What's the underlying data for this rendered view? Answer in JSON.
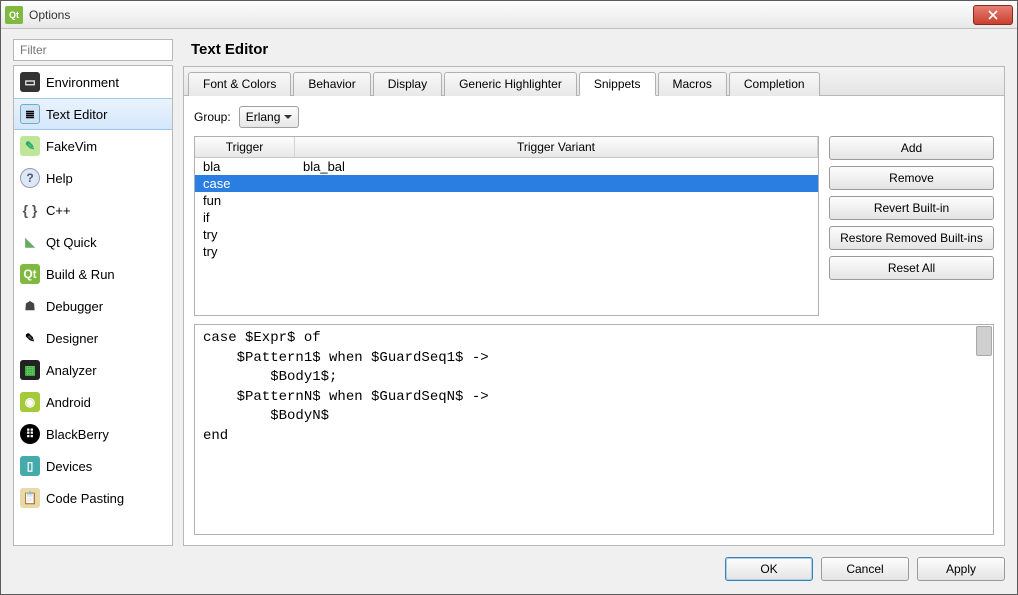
{
  "window": {
    "title": "Options"
  },
  "filter": {
    "placeholder": "Filter"
  },
  "categories": [
    {
      "label": "Environment",
      "icon": "env"
    },
    {
      "label": "Text Editor",
      "icon": "text",
      "selected": true
    },
    {
      "label": "FakeVim",
      "icon": "fakevim"
    },
    {
      "label": "Help",
      "icon": "help"
    },
    {
      "label": "C++",
      "icon": "cpp"
    },
    {
      "label": "Qt Quick",
      "icon": "qtq"
    },
    {
      "label": "Build & Run",
      "icon": "build"
    },
    {
      "label": "Debugger",
      "icon": "debug"
    },
    {
      "label": "Designer",
      "icon": "design"
    },
    {
      "label": "Analyzer",
      "icon": "analyze"
    },
    {
      "label": "Android",
      "icon": "android"
    },
    {
      "label": "BlackBerry",
      "icon": "bb"
    },
    {
      "label": "Devices",
      "icon": "devices"
    },
    {
      "label": "Code Pasting",
      "icon": "paste"
    }
  ],
  "page": {
    "title": "Text Editor"
  },
  "tabs": [
    {
      "label": "Font & Colors"
    },
    {
      "label": "Behavior"
    },
    {
      "label": "Display"
    },
    {
      "label": "Generic Highlighter"
    },
    {
      "label": "Snippets",
      "active": true
    },
    {
      "label": "Macros"
    },
    {
      "label": "Completion"
    }
  ],
  "group": {
    "label": "Group:",
    "value": "Erlang"
  },
  "table": {
    "headers": {
      "trigger": "Trigger",
      "variant": "Trigger Variant"
    },
    "rows": [
      {
        "trigger": "bla",
        "variant": "bla_bal"
      },
      {
        "trigger": "case",
        "variant": "",
        "selected": true
      },
      {
        "trigger": "fun",
        "variant": ""
      },
      {
        "trigger": "if",
        "variant": ""
      },
      {
        "trigger": "try",
        "variant": ""
      },
      {
        "trigger": "try",
        "variant": ""
      }
    ]
  },
  "buttons": {
    "add": "Add",
    "remove": "Remove",
    "revert": "Revert Built-in",
    "restore": "Restore Removed Built-ins",
    "reset": "Reset All"
  },
  "snippet": "case $Expr$ of\n    $Pattern1$ when $GuardSeq1$ ->\n        $Body1$;\n    $PatternN$ when $GuardSeqN$ ->\n        $BodyN$\nend",
  "footer": {
    "ok": "OK",
    "cancel": "Cancel",
    "apply": "Apply"
  }
}
